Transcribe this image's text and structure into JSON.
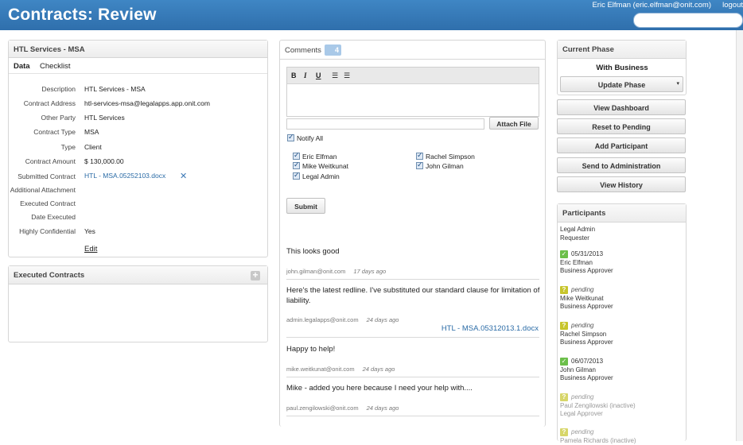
{
  "header": {
    "title": "Contracts: Review",
    "user": "Eric Elfman (eric.elfman@onit.com)",
    "logout": "logout"
  },
  "contract": {
    "title": "HTL Services - MSA",
    "tabs": [
      "Data",
      "Checklist"
    ],
    "fields": [
      {
        "label": "Description",
        "value": "HTL Services - MSA"
      },
      {
        "label": "Contract Address",
        "value": "htl-services-msa@legalapps.app.onit.com"
      },
      {
        "label": "Other Party",
        "value": "HTL Services"
      },
      {
        "label": "Contract Type",
        "value": "MSA"
      },
      {
        "label": "Type",
        "value": "Client"
      },
      {
        "label": "Contract Amount",
        "value": "$ 130,000.00"
      },
      {
        "label": "Submitted Contract",
        "value": "HTL - MSA.05252103.docx"
      },
      {
        "label": "Additional Attachment",
        "value": ""
      },
      {
        "label": "Executed Contract",
        "value": ""
      },
      {
        "label": "Date Executed",
        "value": ""
      },
      {
        "label": "Highly Confidential",
        "value": "Yes"
      }
    ],
    "edit_label": "Edit"
  },
  "executed": {
    "title": "Executed Contracts",
    "add_icon": "plus-icon"
  },
  "comments": {
    "title": "Comments",
    "count": "4",
    "toolbar": [
      "B",
      "I",
      "U"
    ],
    "attach_label": "Attach File",
    "notify_all": "Notify All",
    "recipients": [
      "Eric Elfman",
      "Mike Weitkunat",
      "Legal Admin",
      "Rachel Simpson",
      "John Gilman"
    ],
    "submit_label": "Submit",
    "items": [
      {
        "text": "This looks good",
        "author": "john.gilman@onit.com",
        "when": "17 days ago",
        "attachment": ""
      },
      {
        "text": "Here's the latest redline.  I've substituted our standard clause for limitation of liability.",
        "author": "admin.legalapps@onit.com",
        "when": "24 days ago",
        "attachment": "HTL - MSA.05312013.1.docx"
      },
      {
        "text": "Happy to help!",
        "author": "mike.weitkunat@onit.com",
        "when": "24 days ago",
        "attachment": ""
      },
      {
        "text": "Mike - added you here because I need your help with....",
        "author": "paul.zengilowski@onit.com",
        "when": "24 days ago",
        "attachment": ""
      }
    ]
  },
  "phase": {
    "title": "Current Phase",
    "value": "With Business",
    "update_label": "Update Phase",
    "actions": [
      "View Dashboard",
      "Reset to Pending",
      "Add Participant",
      "Send to Administration",
      "View History"
    ]
  },
  "participants": {
    "title": "Participants",
    "items": [
      {
        "status": "",
        "name": "Legal Admin",
        "role": "Requester"
      },
      {
        "status": "05/31/2013",
        "name": "Eric Elfman",
        "role": "Business Approver"
      },
      {
        "status": "pending",
        "name": "Mike Weitkunat",
        "role": "Business Approver"
      },
      {
        "status": "pending",
        "name": "Rachel Simpson",
        "role": "Business Approver"
      },
      {
        "status": "06/07/2013",
        "name": "John Gilman",
        "role": "Business Approver"
      },
      {
        "status": "pending",
        "name": "Paul Zengilowski (inactive)",
        "role": "Legal Approver"
      },
      {
        "status": "pending",
        "name": "Pamela Richards (inactive)",
        "role": ""
      }
    ]
  }
}
